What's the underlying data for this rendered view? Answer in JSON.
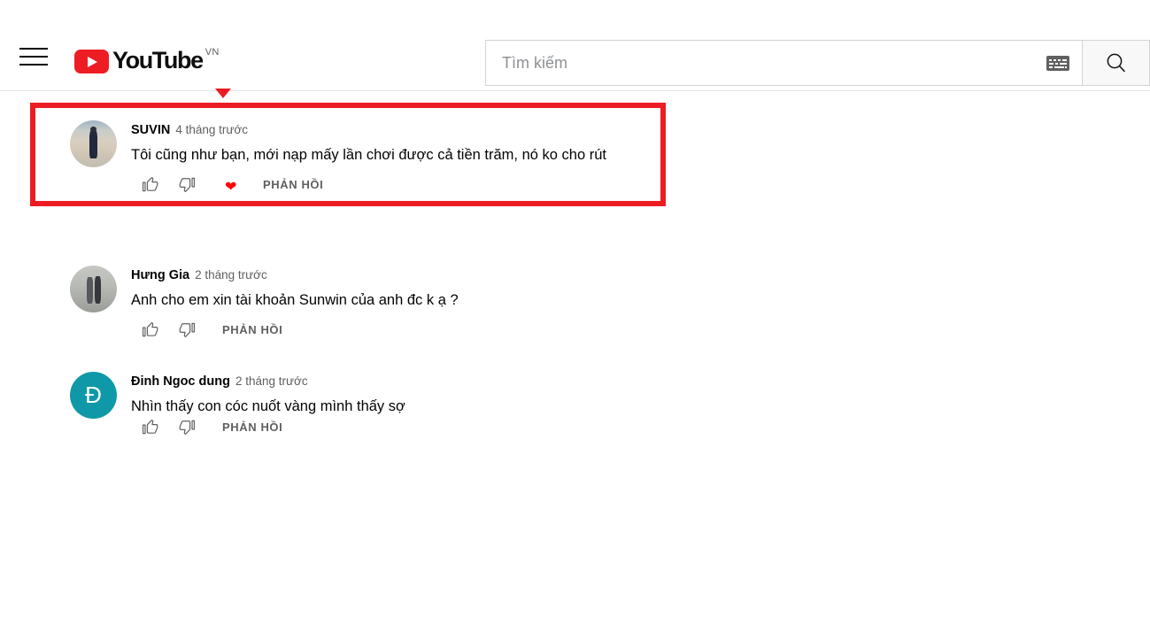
{
  "header": {
    "menu_icon": "hamburger-menu-icon",
    "logo_word": "YouTube",
    "logo_country": "VN",
    "search": {
      "placeholder": "Tìm kiếm",
      "value": "",
      "keyboard_icon": "keyboard-icon",
      "search_icon": "search-icon"
    }
  },
  "comments": [
    {
      "author": "SUVIN",
      "timestamp": "4 tháng trước",
      "text": "Tôi cũng như bạn, mới nạp mấy lần chơi được cả tiền trăm, nó ko cho rút",
      "reply_label": "PHẢN HỒI",
      "avatar_type": "photo",
      "has_creator_heart": true,
      "highlighted": true
    },
    {
      "author": "Hưng Gia",
      "timestamp": "2 tháng trước",
      "text": "Anh cho em xin tài khoản Sunwin của anh đc k ạ ?",
      "reply_label": "PHẢN HỒI",
      "avatar_type": "photo",
      "has_creator_heart": false,
      "highlighted": false
    },
    {
      "author": "Đinh Ngoc dung",
      "timestamp": "2 tháng trước",
      "text": "Nhìn thấy con cóc nuốt vàng mình thấy sợ",
      "reply_label": "PHẢN HỒI",
      "avatar_type": "letter",
      "avatar_letter": "Đ",
      "avatar_color": "#0f99a8",
      "has_creator_heart": false,
      "highlighted": false
    }
  ],
  "annotation": {
    "type": "red-highlight-box",
    "color": "#ed1c24",
    "arrow": "down-triangle-marker"
  }
}
